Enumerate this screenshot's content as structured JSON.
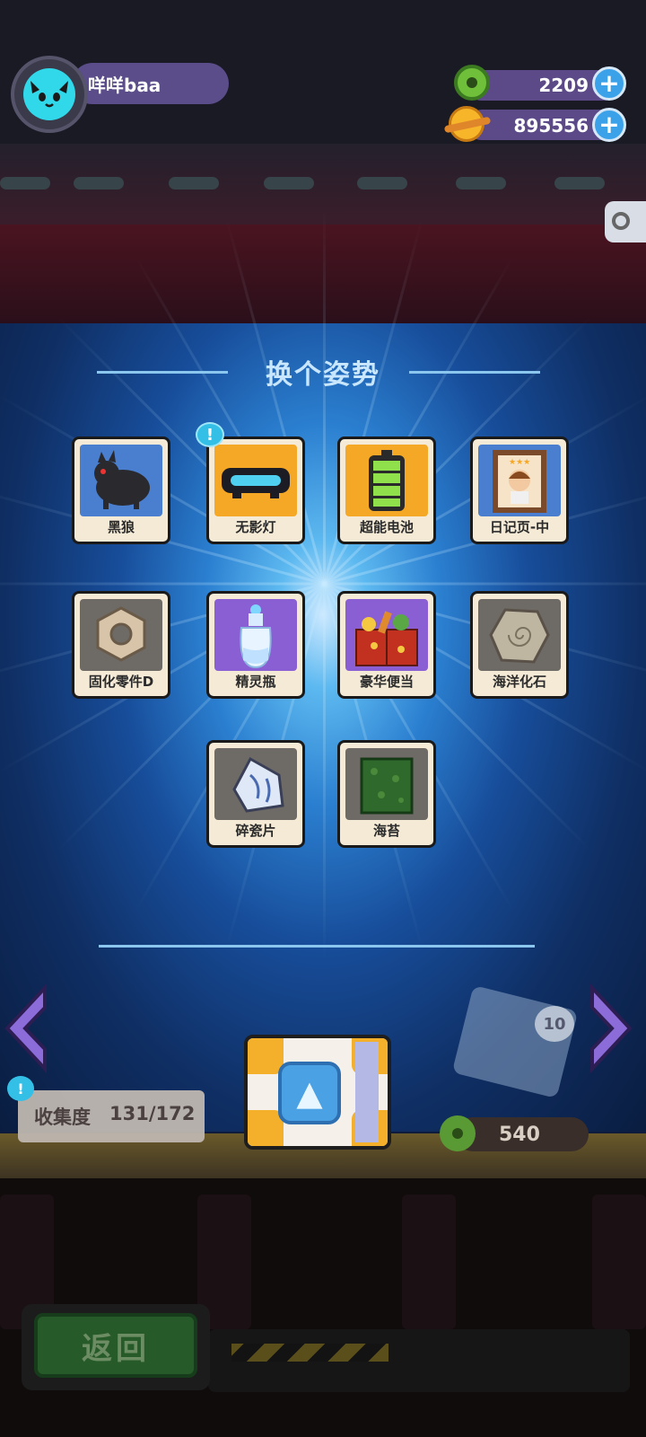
{
  "profile": {
    "name": "咩咩baa"
  },
  "currencies": [
    {
      "value": "2209",
      "icon": "green-donut-coin-icon"
    },
    {
      "value": "895556",
      "icon": "golden-planet-coin-icon"
    }
  ],
  "panel": {
    "title": "换个姿势",
    "items": [
      {
        "label": "黑狼",
        "bg": "#4a7fd0",
        "icon": "black-wolf-icon",
        "new": false
      },
      {
        "label": "无影灯",
        "bg": "#f5a826",
        "icon": "shadowless-lamp-icon",
        "new": true
      },
      {
        "label": "超能电池",
        "bg": "#f5a826",
        "icon": "battery-icon",
        "new": false
      },
      {
        "label": "日记页-中",
        "bg": "#4a7fd0",
        "icon": "diary-page-portrait-icon",
        "new": false
      },
      {
        "label": "固化零件D",
        "bg": "#6e6a66",
        "icon": "hex-nut-icon",
        "new": false
      },
      {
        "label": "精灵瓶",
        "bg": "#8b5fd4",
        "icon": "spirit-bottle-icon",
        "new": false
      },
      {
        "label": "豪华便当",
        "bg": "#8b5fd4",
        "icon": "deluxe-bento-icon",
        "new": false
      },
      {
        "label": "海洋化石",
        "bg": "#6e6a66",
        "icon": "ocean-fossil-icon",
        "new": false
      },
      {
        "label": "碎瓷片",
        "bg": "#6e6a66",
        "icon": "porcelain-shard-icon",
        "new": false
      },
      {
        "label": "海苔",
        "bg": "#6e6a66",
        "icon": "seaweed-icon",
        "new": false
      }
    ],
    "badge_symbol": "!"
  },
  "collection": {
    "label": "收集度",
    "value": "131/172",
    "badge": "!"
  },
  "cost": {
    "value": "540"
  },
  "mini_card_count": "10",
  "back_button": {
    "label": "返回"
  }
}
